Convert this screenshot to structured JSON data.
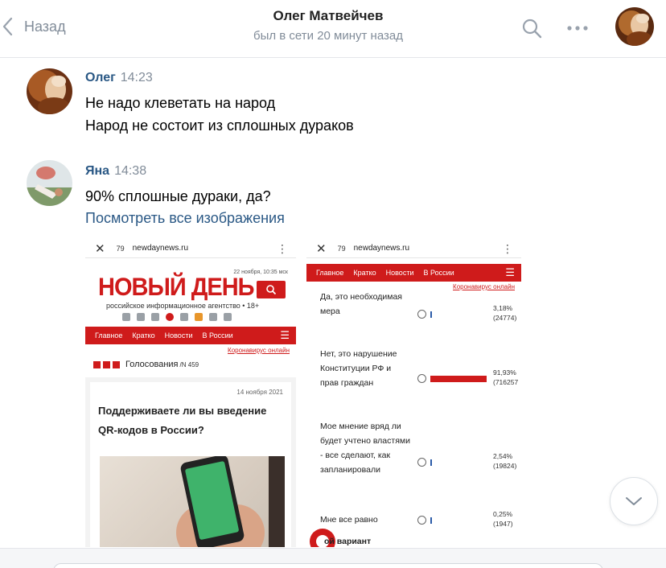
{
  "header": {
    "back_label": "Назад",
    "title": "Олег Матвейчев",
    "status": "был в сети 20 минут назад"
  },
  "messages": [
    {
      "author": "Олег",
      "time": "14:23",
      "lines": [
        "Не надо клеветать на народ",
        "Народ не состоит из сплошных дураков"
      ]
    },
    {
      "author": "Яна",
      "time": "14:38",
      "lines": [
        "90% сплошные дураки, да?"
      ],
      "link": "Посмотреть все изображения"
    }
  ],
  "attachment": {
    "left_phone": {
      "signal": "79",
      "url": "newdaynews.ru",
      "logo": "НОВЫЙ ДЕНЬ",
      "date_time": "22 ноября, 10:35 мск",
      "subtitle": "российское информационное агентство • 18+",
      "nav": [
        "Главное",
        "Кратко",
        "Новости",
        "В России"
      ],
      "covid_link": "Коронавирус онлайн",
      "polls_title": "Голосования",
      "polls_count": "/N 459",
      "question_date": "14 ноября 2021",
      "question": "Поддерживаете ли вы введение QR-кодов в России?"
    },
    "right_phone": {
      "signal": "79",
      "url": "newdaynews.ru",
      "nav": [
        "Главное",
        "Кратко",
        "Новости",
        "В России"
      ],
      "covid_link": "Коронавирус онлайн",
      "options": [
        {
          "text": "Да, это необходимая мера",
          "pct": "3,18%",
          "votes": "(24774)",
          "share": 3.18
        },
        {
          "text": "Нет, это нарушение Конституции РФ и прав граждан",
          "pct": "91,93%",
          "votes": "(716257",
          "share": 91.93
        },
        {
          "text": "Мое мнение вряд ли будет учтено властями - все сделают, как запланировали",
          "pct": "2,54%",
          "votes": "(19824)",
          "share": 2.54
        },
        {
          "text": "Мне все равно",
          "pct": "0,25%",
          "votes": "(1947)",
          "share": 0.25
        }
      ],
      "last_option": "ой вариант"
    }
  }
}
